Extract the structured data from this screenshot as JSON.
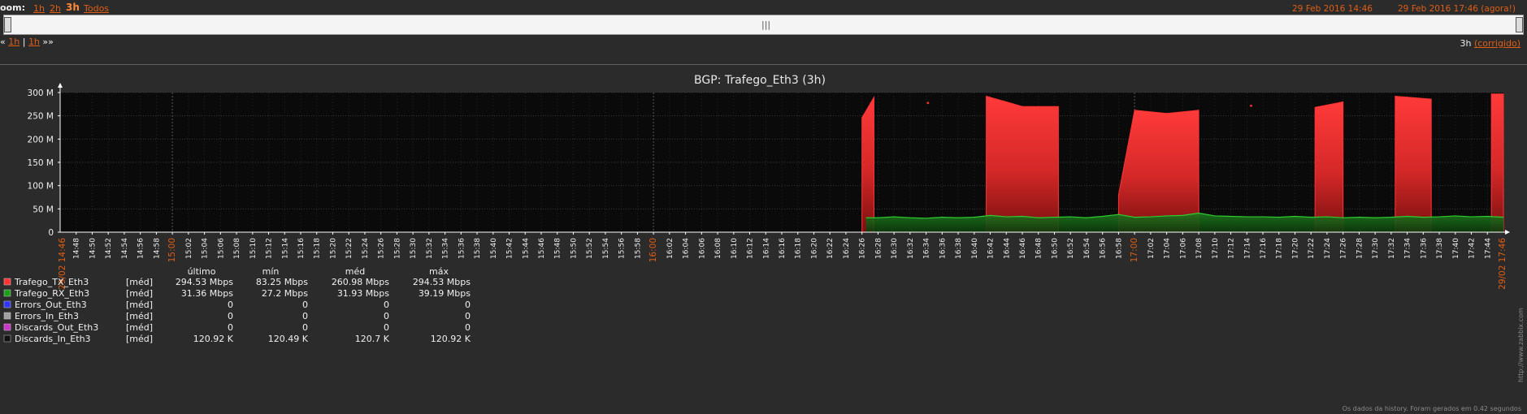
{
  "zoom": {
    "label": "oom:",
    "options": [
      "1h",
      "2h",
      "3h",
      "Todos"
    ],
    "active": "3h",
    "range_start": "29 Feb 2016 14:46",
    "range_end": "29 Feb 2016 17:46 (agora!)"
  },
  "scrollbar": {
    "grip": "|||"
  },
  "nav": {
    "back": "«",
    "back_1h": "1h",
    "sep": "|",
    "fwd_1h": "1h",
    "fwd": "»»",
    "period": "3h",
    "fixed": "(corrigido)"
  },
  "footer": {
    "note": "Os dados da history. Foram gerados em 0.42 segundos",
    "side_url": "http://www.zabbix.com"
  },
  "colors": {
    "tx": "#ff3333",
    "rx": "#1a9e1a",
    "errors_out": "#3333ff",
    "errors_in": "#a0a0a0",
    "discards_out": "#cc33cc",
    "discards_in": "#111111",
    "time_label": "#e05e14"
  },
  "chart_data": {
    "type": "area",
    "title": "BGP: Trafego_Eth3 (3h)",
    "ylim": [
      0,
      300
    ],
    "yticks": [
      "0",
      "50 M",
      "100 M",
      "150 M",
      "200 M",
      "250 M",
      "300 M"
    ],
    "x_tick_labels": [
      "14:48",
      "14:50",
      "14:52",
      "14:54",
      "14:56",
      "14:58",
      "15:00",
      "15:02",
      "15:04",
      "15:06",
      "15:08",
      "15:10",
      "15:12",
      "15:14",
      "15:16",
      "15:18",
      "15:20",
      "15:22",
      "15:24",
      "15:26",
      "15:28",
      "15:30",
      "15:32",
      "15:34",
      "15:36",
      "15:38",
      "15:40",
      "15:42",
      "15:44",
      "15:46",
      "15:48",
      "15:50",
      "15:52",
      "15:54",
      "15:56",
      "15:58",
      "16:00",
      "16:02",
      "16:04",
      "16:06",
      "16:08",
      "16:10",
      "16:12",
      "16:14",
      "16:16",
      "16:18",
      "16:20",
      "16:22",
      "16:24",
      "16:26",
      "16:28",
      "16:30",
      "16:32",
      "16:34",
      "16:36",
      "16:38",
      "16:40",
      "16:42",
      "16:44",
      "16:46",
      "16:48",
      "16:50",
      "16:52",
      "16:54",
      "16:56",
      "16:58",
      "17:00",
      "17:02",
      "17:04",
      "17:06",
      "17:08",
      "17:10",
      "17:12",
      "17:14",
      "17:16",
      "17:18",
      "17:20",
      "17:22",
      "17:24",
      "17:26",
      "17:28",
      "17:30",
      "17:32",
      "17:34",
      "17:36",
      "17:38",
      "17:40",
      "17:42",
      "17:44"
    ],
    "x_highlight": [
      "15:00",
      "16:00",
      "17:00"
    ],
    "x_edge_labels": [
      "29/02 14:46",
      "29/02 17:46"
    ],
    "x_range_minutes": [
      0,
      180
    ],
    "series": [
      {
        "name": "Trafego_TX_Eth3",
        "color": "#ff3333",
        "segments": [
          [
            [
              100.0,
              246
            ],
            [
              101.5,
              290
            ]
          ],
          [
            [
              115.5,
              292
            ],
            [
              118,
              280
            ],
            [
              120,
              270
            ],
            [
              124.5,
              270
            ]
          ],
          [
            [
              132,
              80
            ],
            [
              134,
              262
            ],
            [
              138,
              255
            ],
            [
              142,
              262
            ]
          ],
          [
            [
              156.5,
              268
            ],
            [
              160,
              280
            ]
          ],
          [
            [
              166.5,
              292
            ],
            [
              171,
              286
            ]
          ],
          [
            [
              178.5,
              297
            ],
            [
              180,
              297
            ]
          ]
        ],
        "points": [
          [
            108.2,
            278
          ],
          [
            148.5,
            272
          ]
        ]
      },
      {
        "name": "Trafego_RX_Eth3",
        "color": "#1a9e1a",
        "x": [
          100.5,
          102,
          104,
          106,
          108,
          110,
          112,
          114,
          116,
          118,
          120,
          122,
          124,
          126,
          128,
          130,
          132,
          134,
          136,
          138,
          140,
          142,
          144,
          146,
          148,
          150,
          152,
          154,
          156,
          158,
          160,
          162,
          164,
          166,
          168,
          170,
          172,
          174,
          176,
          178,
          180
        ],
        "values": [
          31,
          31,
          33,
          31,
          30,
          32,
          31,
          32,
          36,
          33,
          34,
          31,
          32,
          33,
          31,
          34,
          38,
          32,
          33,
          35,
          36,
          41,
          35,
          34,
          33,
          33,
          32,
          34,
          32,
          33,
          31,
          32,
          31,
          32,
          34,
          32,
          33,
          35,
          33,
          34,
          32
        ]
      }
    ],
    "legend_headers": [
      "último",
      "mín",
      "méd",
      "máx"
    ],
    "legend": [
      {
        "name": "Trafego_TX_Eth3",
        "func": "[méd]",
        "last": "294.53 Mbps",
        "min": "83.25 Mbps",
        "avg": "260.98 Mbps",
        "max": "294.53 Mbps",
        "color": "#ff3333"
      },
      {
        "name": "Trafego_RX_Eth3",
        "func": "[méd]",
        "last": "31.36 Mbps",
        "min": "27.2 Mbps",
        "avg": "31.93 Mbps",
        "max": "39.19 Mbps",
        "color": "#1a9e1a"
      },
      {
        "name": "Errors_Out_Eth3",
        "func": "[méd]",
        "last": "0",
        "min": "0",
        "avg": "0",
        "max": "0",
        "color": "#3333ff"
      },
      {
        "name": "Errors_In_Eth3",
        "func": "[méd]",
        "last": "0",
        "min": "0",
        "avg": "0",
        "max": "0",
        "color": "#a0a0a0"
      },
      {
        "name": "Discards_Out_Eth3",
        "func": "[méd]",
        "last": "0",
        "min": "0",
        "avg": "0",
        "max": "0",
        "color": "#cc33cc"
      },
      {
        "name": "Discards_In_Eth3",
        "func": "[méd]",
        "last": "120.92 K",
        "min": "120.49 K",
        "avg": "120.7 K",
        "max": "120.92 K",
        "color": "#111111"
      }
    ]
  }
}
